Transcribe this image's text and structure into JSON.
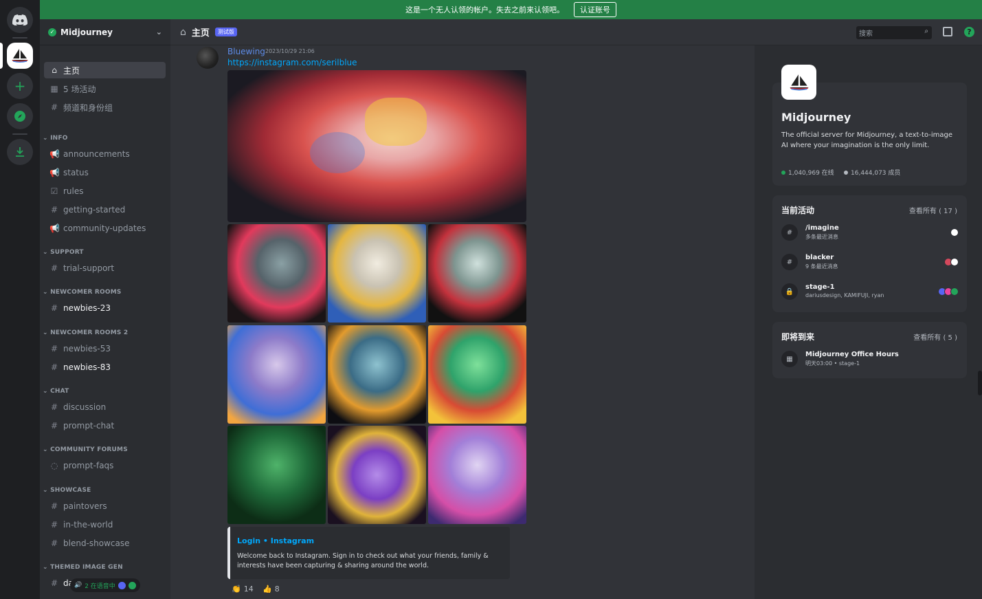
{
  "banner": {
    "message": "这是一个无人认领的帐户。失去之前来认领吧。",
    "verify_label": "认证账号"
  },
  "server": {
    "name": "Midjourney",
    "header_name": "Midjourney"
  },
  "sidebar": {
    "top_items": [
      {
        "label": "主页",
        "icon": "home-icon"
      },
      {
        "label": "5 场活动",
        "icon": "calendar-icon"
      },
      {
        "label": "频道和身份组",
        "icon": "channels-roles-icon"
      }
    ],
    "categories": [
      {
        "label": "INFO",
        "channels": [
          {
            "label": "announcements",
            "icon": "announcement-icon"
          },
          {
            "label": "status",
            "icon": "announcement-icon"
          },
          {
            "label": "rules",
            "icon": "rules-icon"
          },
          {
            "label": "getting-started",
            "icon": "hash-icon"
          },
          {
            "label": "community-updates",
            "icon": "announcement-icon"
          }
        ]
      },
      {
        "label": "SUPPORT",
        "channels": [
          {
            "label": "trial-support",
            "icon": "hash-icon"
          }
        ]
      },
      {
        "label": "NEWCOMER ROOMS",
        "channels": [
          {
            "label": "newbies-23",
            "icon": "threads-icon"
          }
        ]
      },
      {
        "label": "NEWCOMER ROOMS 2",
        "channels": [
          {
            "label": "newbies-53",
            "icon": "threads-icon"
          },
          {
            "label": "newbies-83",
            "icon": "threads-icon"
          }
        ]
      },
      {
        "label": "CHAT",
        "channels": [
          {
            "label": "discussion",
            "icon": "threads-icon"
          },
          {
            "label": "prompt-chat",
            "icon": "threads-icon"
          }
        ]
      },
      {
        "label": "COMMUNITY FORUMS",
        "channels": [
          {
            "label": "prompt-faqs",
            "icon": "forum-icon"
          }
        ]
      },
      {
        "label": "SHOWCASE",
        "channels": [
          {
            "label": "paintovers",
            "icon": "hash-icon"
          },
          {
            "label": "in-the-world",
            "icon": "hash-icon"
          },
          {
            "label": "blend-showcase",
            "icon": "hash-icon"
          }
        ]
      },
      {
        "label": "THEMED IMAGE GEN",
        "channels": [
          {
            "label": "da",
            "icon": "threads-icon"
          }
        ]
      }
    ],
    "voice_status": "2 在语音中"
  },
  "header": {
    "title": "主页",
    "badge": "测试版",
    "search_placeholder": "搜索"
  },
  "message": {
    "author": "Bluewing",
    "timestamp": "2023/10/29 21:06",
    "link": "https://instagram.com/serilblue",
    "embed": {
      "provider": "Login • Instagram",
      "description": "Welcome back to Instagram. Sign in to check out what your friends, family & interests have been capturing & sharing around the world."
    },
    "reactions": [
      {
        "emoji": "👏",
        "count": "14"
      },
      {
        "emoji": "👍",
        "count": "8"
      }
    ]
  },
  "right_panel": {
    "server_name": "Midjourney",
    "description": "The official server for Midjourney, a text-to-image AI where your imagination is the only limit.",
    "online": "1,040,969 在线",
    "members": "16,444,073 成员",
    "activity": {
      "title": "当前活动",
      "see_all": "查看所有 ( 17 )",
      "items": [
        {
          "name": "/imagine",
          "sub": "多条最近消息",
          "icon": "threads-icon"
        },
        {
          "name": "blacker",
          "sub": "9 条最近消息",
          "icon": "threads-icon"
        },
        {
          "name": "stage-1",
          "sub": "dariusdesign, KAMIFUJI, ryan",
          "icon": "lock-icon"
        }
      ]
    },
    "upcoming": {
      "title": "即将到来",
      "see_all": "查看所有 ( 5 )",
      "items": [
        {
          "name": "Midjourney Office Hours",
          "sub": "明天03:00 • stage-1",
          "icon": "calendar-icon"
        }
      ]
    }
  },
  "colors": {
    "banner": "#248046",
    "link": "#00a8fc",
    "username": "#5e8ce8",
    "online": "#23a55a"
  }
}
